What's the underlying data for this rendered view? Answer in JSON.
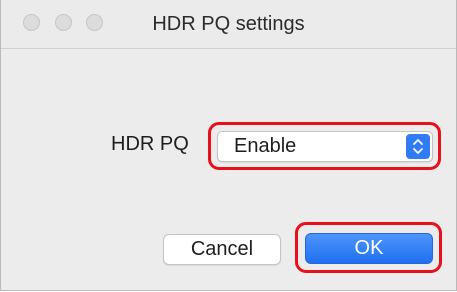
{
  "window": {
    "title": "HDR PQ settings",
    "traffic_lights": [
      "close",
      "minimize",
      "zoom"
    ]
  },
  "form": {
    "hdr_pq_label": "HDR PQ",
    "hdr_pq_value": "Enable",
    "stepper_icon": "up-down-chevron-icon"
  },
  "buttons": {
    "cancel_label": "Cancel",
    "ok_label": "OK"
  },
  "colors": {
    "highlight": "#e8101c",
    "accent": "#2f7cf6"
  }
}
